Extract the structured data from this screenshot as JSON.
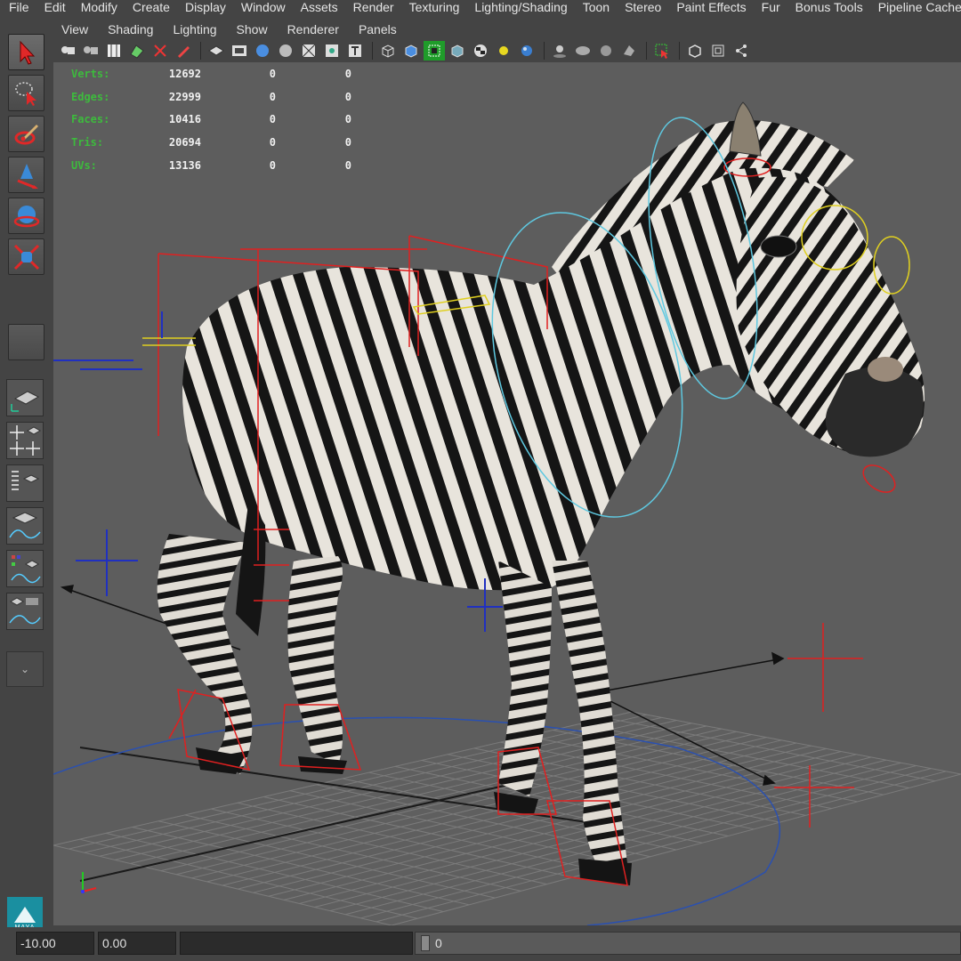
{
  "menu": [
    "File",
    "Edit",
    "Modify",
    "Create",
    "Display",
    "Window",
    "Assets",
    "Render",
    "Texturing",
    "Lighting/Shading",
    "Toon",
    "Stereo",
    "Paint Effects",
    "Fur",
    "Bonus Tools",
    "Pipeline Cache"
  ],
  "panel_menu": [
    "View",
    "Shading",
    "Lighting",
    "Show",
    "Renderer",
    "Panels"
  ],
  "hud": {
    "rows": [
      {
        "label": "Verts:",
        "values": [
          "12692",
          "0",
          "0"
        ]
      },
      {
        "label": "Edges:",
        "values": [
          "22999",
          "0",
          "0"
        ]
      },
      {
        "label": "Faces:",
        "values": [
          "10416",
          "0",
          "0"
        ]
      },
      {
        "label": "Tris:",
        "values": [
          "20694",
          "0",
          "0"
        ]
      },
      {
        "label": "UVs:",
        "values": [
          "13136",
          "0",
          "0"
        ]
      }
    ]
  },
  "tools": [
    "select-tool",
    "lasso-tool",
    "paint-select-tool",
    "move-tool",
    "rotate-tool",
    "scale-tool"
  ],
  "bottom": {
    "range_start": "-10.00",
    "range_current": "0.00",
    "current_frame": "0"
  },
  "logo_text": "MAYA",
  "colors": {
    "viewport_bg": "#5d5d5d",
    "hud_label": "#3dbb3d",
    "rig_red": "#e02020",
    "rig_blue": "#2030c0",
    "rig_cyan": "#5ec8e0",
    "rig_yellow": "#e0d020",
    "grid": "#7a7a7a"
  }
}
